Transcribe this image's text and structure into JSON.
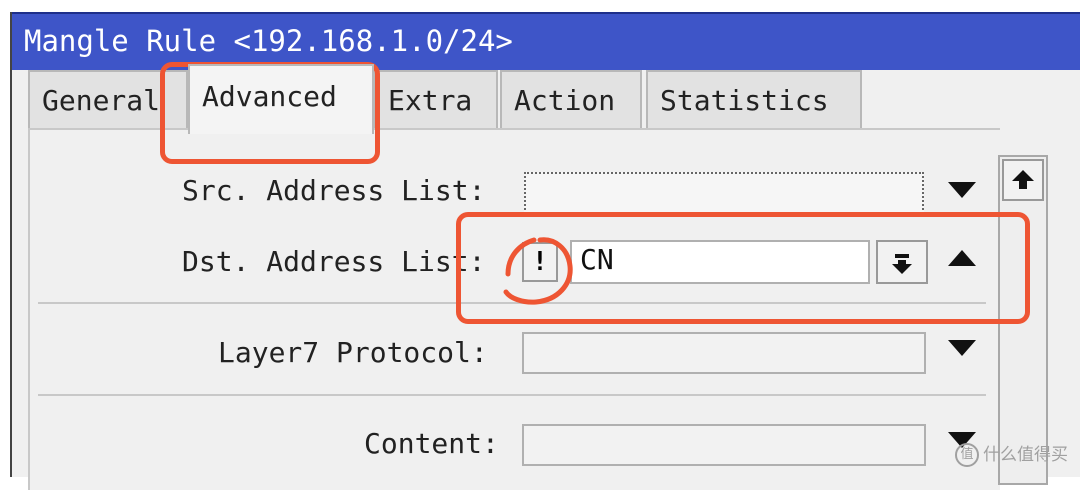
{
  "window": {
    "title": "Mangle Rule <192.168.1.0/24>"
  },
  "tabs": [
    {
      "label": "General",
      "active": false
    },
    {
      "label": "Advanced",
      "active": true
    },
    {
      "label": "Extra",
      "active": false
    },
    {
      "label": "Action",
      "active": false
    },
    {
      "label": "Statistics",
      "active": false
    }
  ],
  "fields": {
    "src_address_list": {
      "label": "Src. Address List:",
      "value": ""
    },
    "dst_address_list": {
      "label": "Dst. Address List:",
      "negate": "!",
      "value": "CN"
    },
    "layer7_protocol": {
      "label": "Layer7 Protocol:",
      "value": ""
    },
    "content": {
      "label": "Content:",
      "value": ""
    }
  },
  "watermark": {
    "text": "什么值得买",
    "icon": "值"
  },
  "colors": {
    "title_bar": "#3e55c8",
    "annotation": "#ee5533"
  },
  "icons": [
    "arrow-up-icon",
    "dropdown-arrow-icon",
    "collapse-arrow-icon",
    "dropdown-arrow-down-icon",
    "negate-icon"
  ]
}
